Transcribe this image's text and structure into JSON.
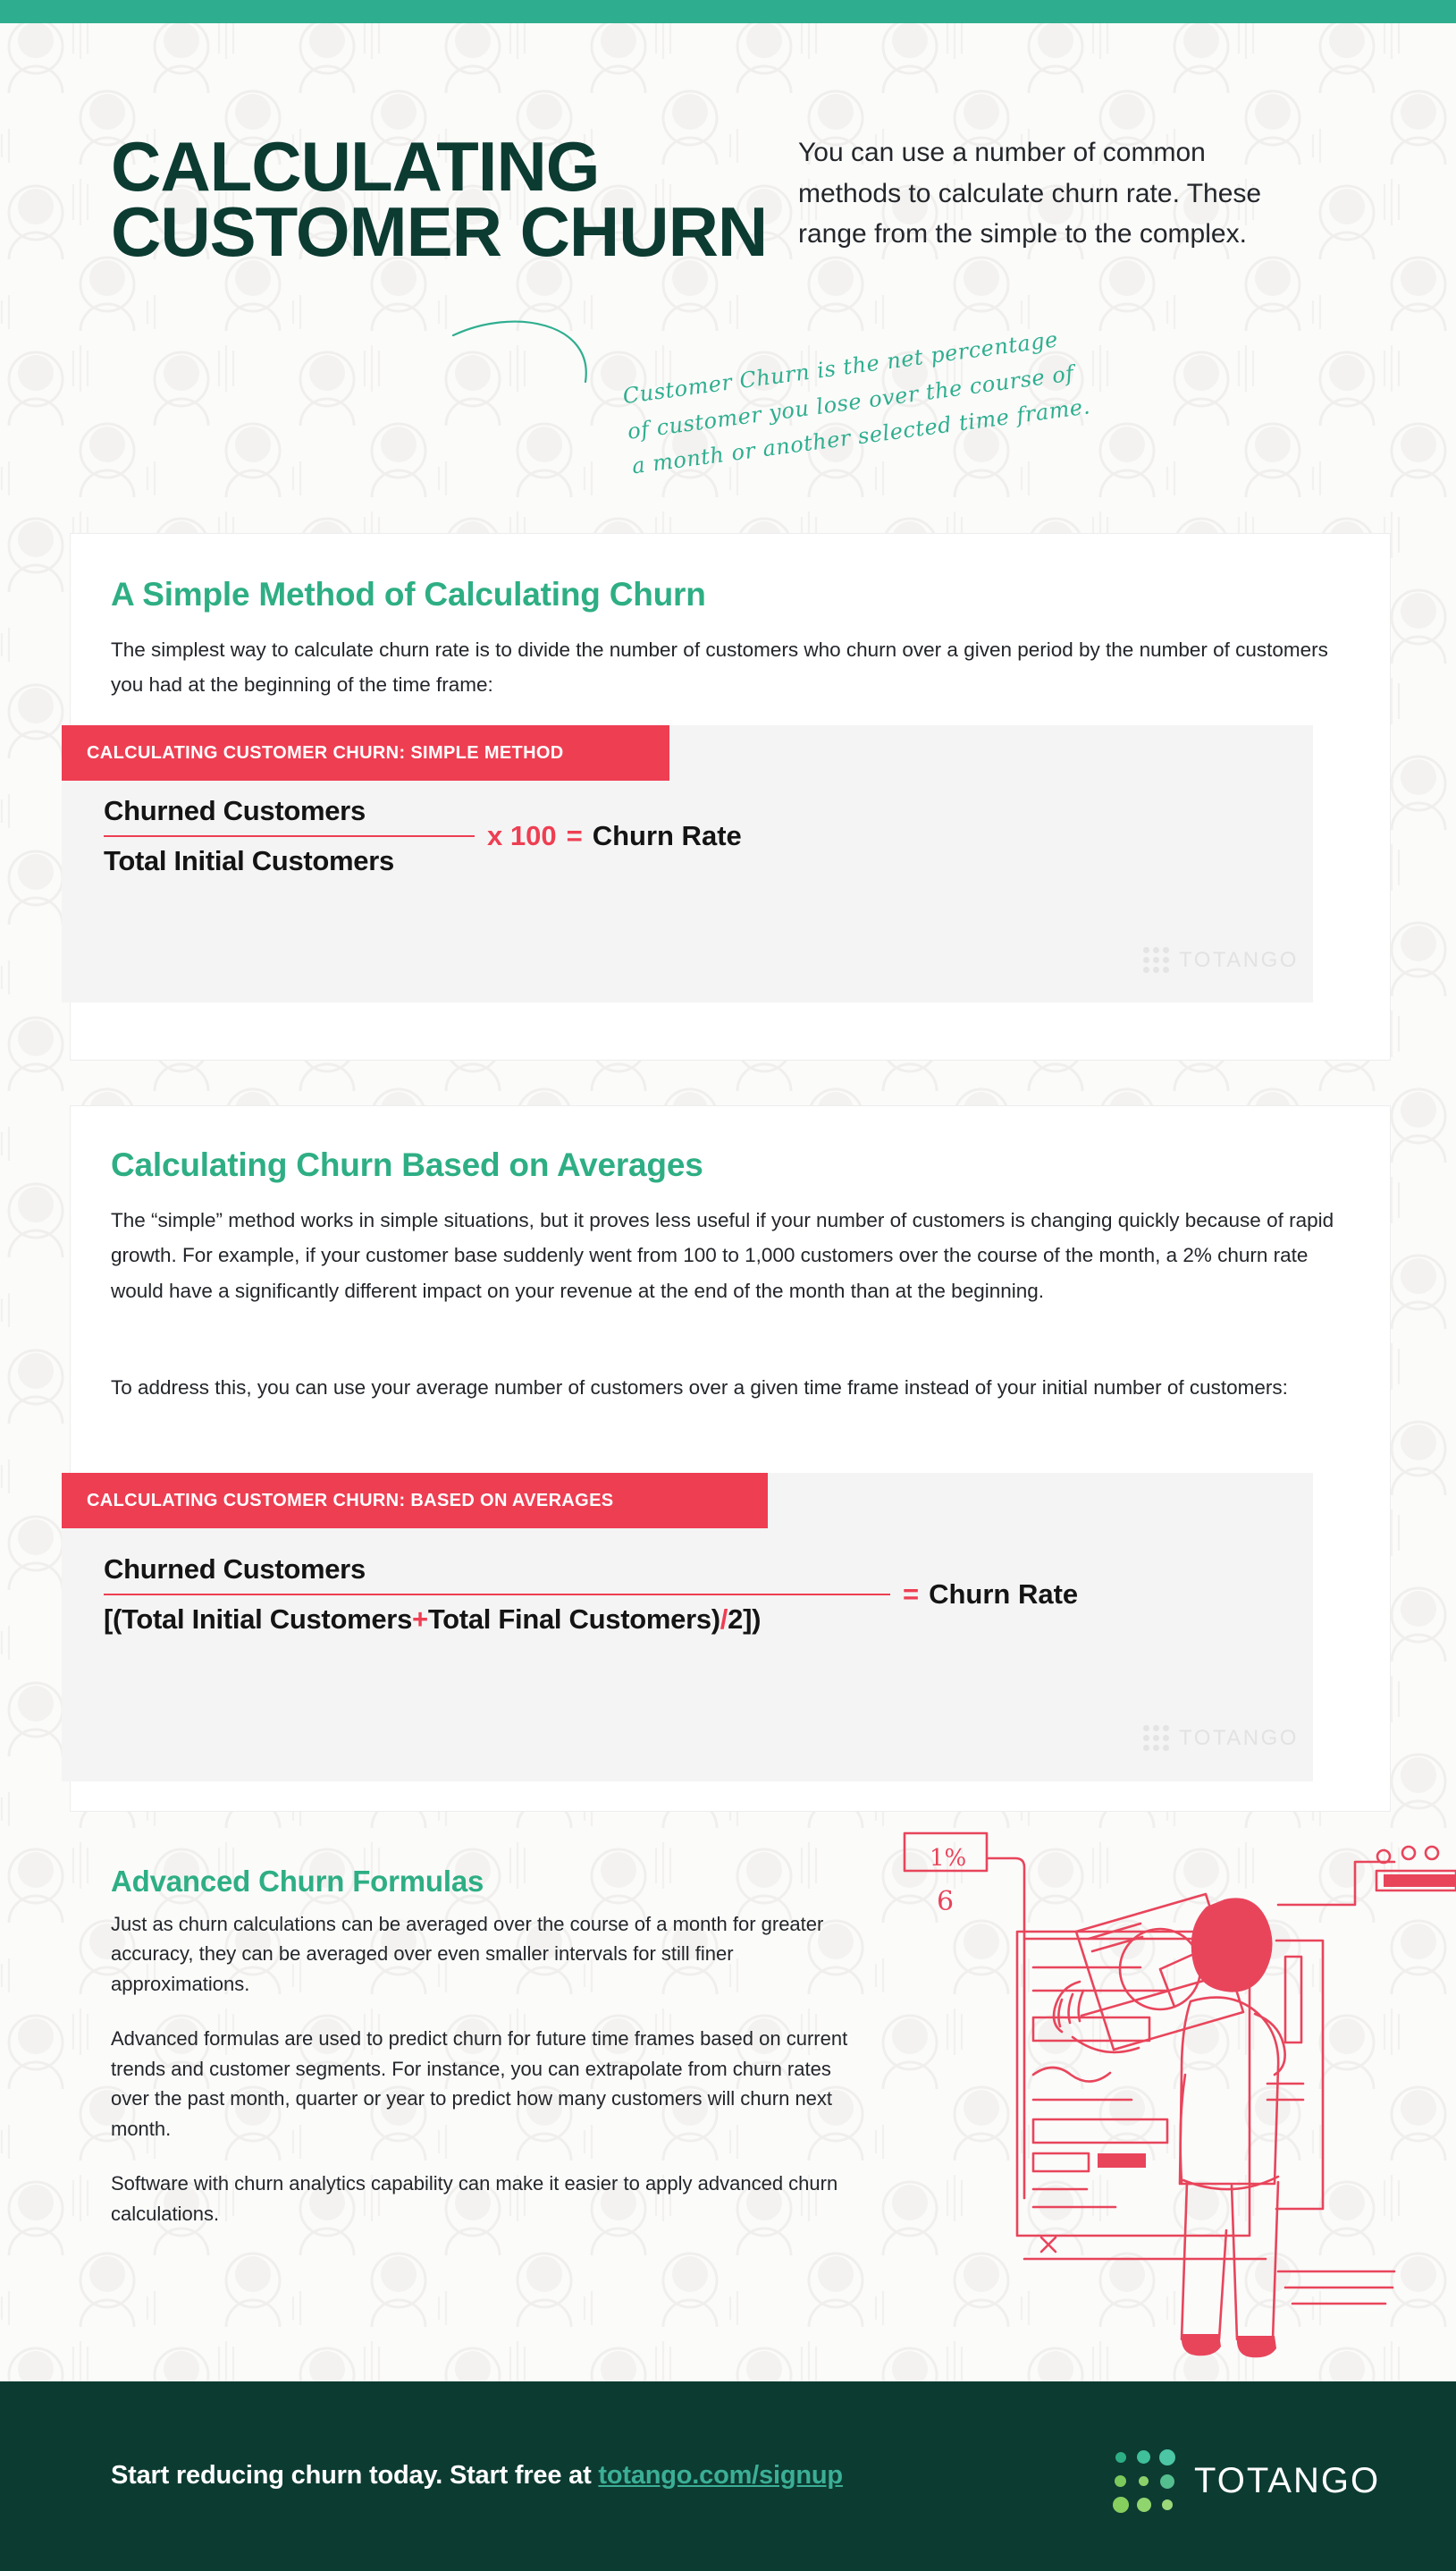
{
  "theme": {
    "accent_green": "#2FAE8F",
    "dark_green": "#0C3B31",
    "title_green": "#2EAE84",
    "accent_red": "#EE3E52",
    "body_text": "#23262A",
    "card_bg": "#FFFFFF",
    "formula_bg": "#F4F4F4",
    "page_bg": "#FBFBFA"
  },
  "header": {
    "title": "CALCULATING CUSTOMER CHURN",
    "intro": "You can use a number of common methods to calculate churn rate. These range from the simple to the complex.",
    "script_note": "Customer Churn is the net percentage of customer you lose over the course of a month or another selected time frame."
  },
  "sections": [
    {
      "id": "simple",
      "title": "A Simple Method of Calculating Churn",
      "body": "The simplest way to calculate churn rate is to divide the number of customers who churn over a given period by the number of customers you had at the beginning of the time frame:",
      "formula": {
        "tag": "CALCULATING CUSTOMER CHURN: SIMPLE METHOD",
        "numerator": "Churned Customers",
        "denominator": "Total Initial Customers",
        "multiplier": "x 100",
        "equals": "=",
        "result": "Churn Rate",
        "watermark": "TOTANGO"
      }
    },
    {
      "id": "averages",
      "title": "Calculating Churn Based on Averages",
      "body_1": "The “simple” method works in simple situations, but it proves less useful if your number of customers is changing quickly because of rapid growth. For example, if your customer base suddenly went from 100 to 1,000 customers over the course of the month, a 2% churn rate would have a significantly different impact on your revenue at the end of the month than at the beginning.",
      "body_2": "To address this, you can use your average number of customers over a given time frame instead of your initial number of customers:",
      "formula": {
        "tag": "CALCULATING CUSTOMER CHURN: BASED ON AVERAGES",
        "numerator": "Churned Customers",
        "den_open": "[(Total Initial Customers",
        "den_plus": "+",
        "den_mid": "Total Final Customers)",
        "den_slash": "/",
        "den_close": "2])",
        "equals": "=",
        "result": "Churn Rate",
        "watermark": "TOTANGO"
      }
    }
  ],
  "advanced": {
    "title": "Advanced Churn Formulas",
    "paragraphs": [
      "Just as churn calculations can be averaged over the course of a month for greater accuracy, they can be averaged over even smaller intervals for still finer approximations.",
      "Advanced formulas are used to predict churn for future time frames based on current trends and customer segments. For instance, you can extrapolate from churn rates over the past month, quarter or year to predict how many customers will churn next month.",
      "Software with churn analytics capability can make it easier to apply advanced churn calculations."
    ]
  },
  "illustration": {
    "label_percent": "1%",
    "label_number": "6",
    "alt": "person-holding-report-illustration"
  },
  "footer": {
    "cta_text": "Start reducing churn today. Start free at ",
    "cta_link": "totango.com/signup",
    "brand": "TOTANGO"
  }
}
